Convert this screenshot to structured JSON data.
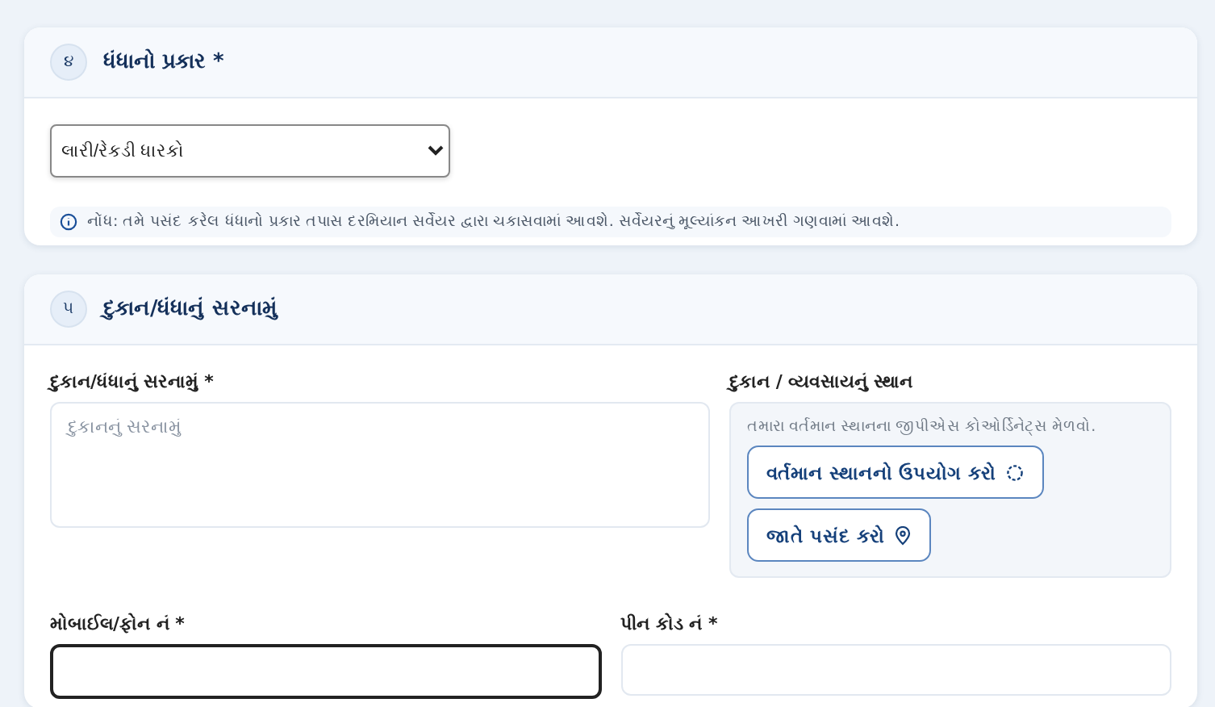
{
  "sections": [
    {
      "number": "૪",
      "title": "ધંધાનો પ્રકાર *",
      "select": {
        "value": "લારી/રેકડી ધારકો"
      },
      "note": "નોંધ: તમે પસંદ કરેલ ધંધાનો પ્રકાર તપાસ દરમિયાન સર્વેયર દ્વારા ચકાસવામાં આવશે. સર્વેયરનું મૂલ્યાંકન આખરી ગણવામાં આવશે."
    },
    {
      "number": "૫",
      "title": "દુકાન/ધંધાનું સરનામું",
      "address": {
        "label": "દુકાન/ધંધાનું સરનામું *",
        "placeholder": "દુકાનનું સરનામું"
      },
      "location": {
        "label": "દુકાન / વ્યવસાયનું સ્થાન",
        "hint": "તમારા વર્તમાન સ્થાનના જીપીએસ કોઓર્ડિનેટ્સ મેળવો.",
        "buttons": [
          {
            "label": "વર્તમાન સ્થાનનો ઉપયોગ કરો",
            "kind": "gps"
          },
          {
            "label": "જાતે પસંદ કરો",
            "kind": "pin"
          }
        ]
      },
      "fields": [
        {
          "label": "મોબાઈલ/ફોન નં *",
          "focused": true
        },
        {
          "label": "પીન કોડ નં *",
          "focused": false
        }
      ]
    }
  ]
}
